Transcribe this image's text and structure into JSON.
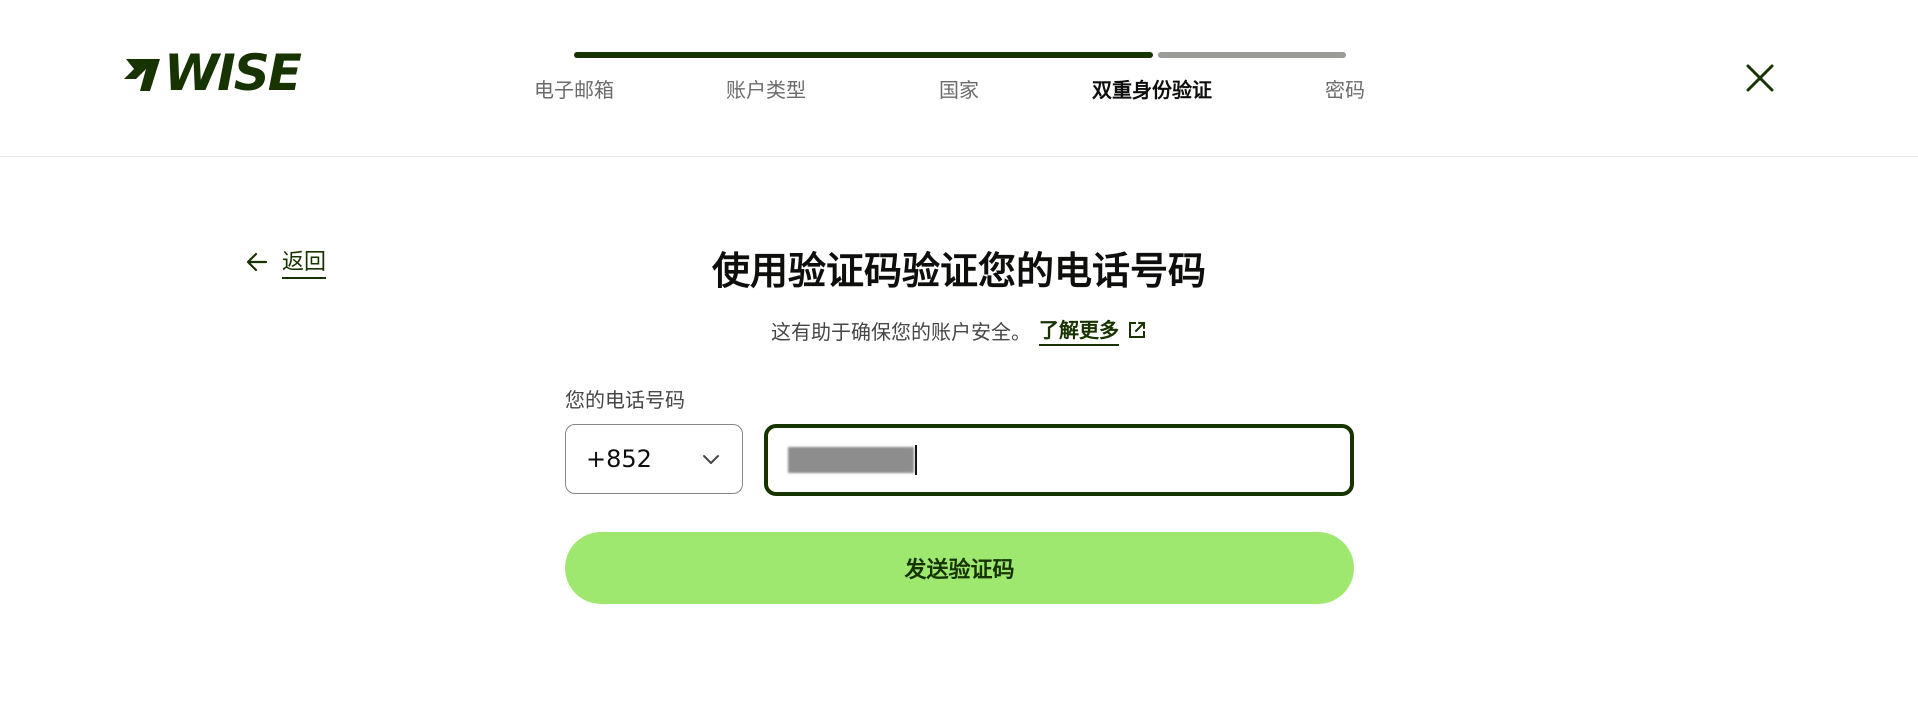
{
  "brand": {
    "name": "WISE",
    "color": "#163300",
    "accent": "#9fe870"
  },
  "stepper": {
    "steps": [
      {
        "label": "电子邮箱",
        "state": "done"
      },
      {
        "label": "账户类型",
        "state": "done"
      },
      {
        "label": "国家",
        "state": "done"
      },
      {
        "label": "双重身份验证",
        "state": "active"
      },
      {
        "label": "密码",
        "state": "todo"
      }
    ]
  },
  "header": {
    "close_icon": "close-icon"
  },
  "nav": {
    "back_label": "返回",
    "back_icon": "arrow-left-icon"
  },
  "main": {
    "title": "使用验证码验证您的电话号码",
    "subtitle": "这有助于确保您的账户安全。",
    "learn_more": "了解更多",
    "phone_label": "您的电话号码",
    "country_code": "+852",
    "phone_value": "17485916",
    "send_button": "发送验证码"
  }
}
